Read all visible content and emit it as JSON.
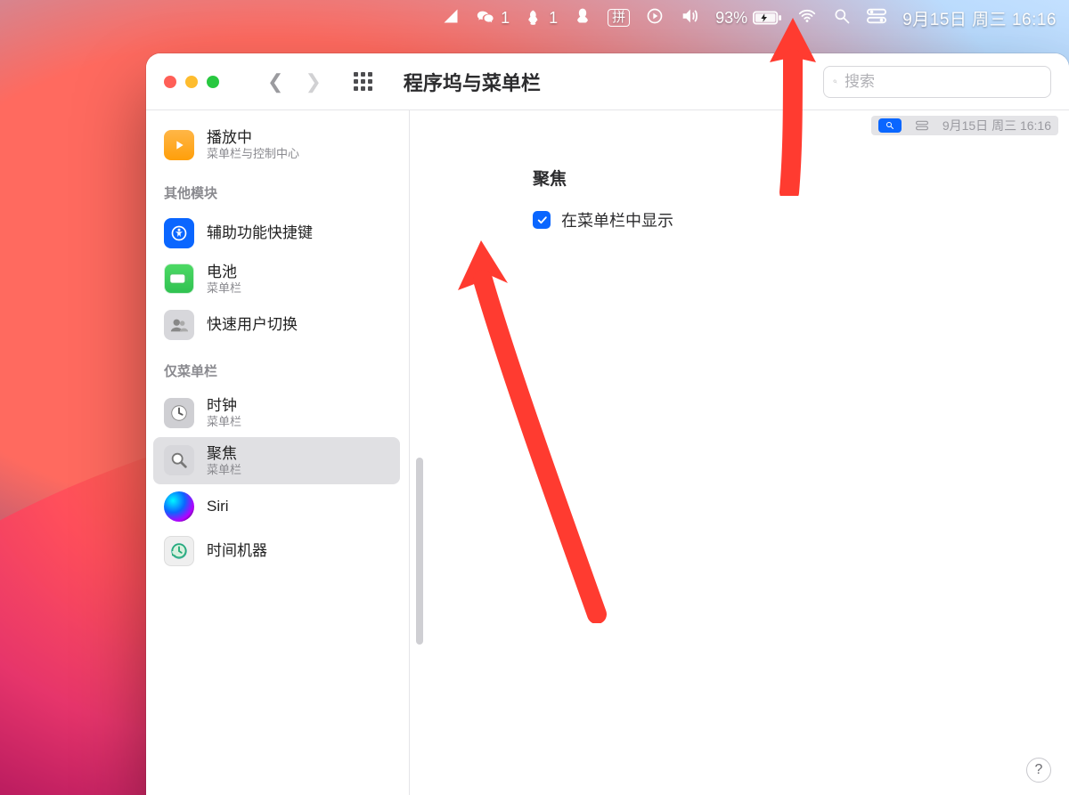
{
  "menubar": {
    "wechat_badge": "1",
    "qq_badge": "1",
    "input_method": "拼",
    "battery_pct": "93%",
    "datetime": "9月15日 周三  16:16"
  },
  "window": {
    "title": "程序坞与菜单栏",
    "search_placeholder": "搜索"
  },
  "sidebar": {
    "now_playing": {
      "title": "播放中",
      "sub": "菜单栏与控制中心"
    },
    "section_other": "其他模块",
    "accessibility": {
      "title": "辅助功能快捷键"
    },
    "battery": {
      "title": "电池",
      "sub": "菜单栏"
    },
    "fast_user": {
      "title": "快速用户切换"
    },
    "section_menubar_only": "仅菜单栏",
    "clock": {
      "title": "时钟",
      "sub": "菜单栏"
    },
    "spotlight": {
      "title": "聚焦",
      "sub": "菜单栏"
    },
    "siri": {
      "title": "Siri"
    },
    "time_machine": {
      "title": "时间机器"
    }
  },
  "content": {
    "preview_datetime": "9月15日 周三  16:16",
    "heading": "聚焦",
    "checkbox_label": "在菜单栏中显示",
    "checkbox_checked": true
  },
  "help_label": "?"
}
